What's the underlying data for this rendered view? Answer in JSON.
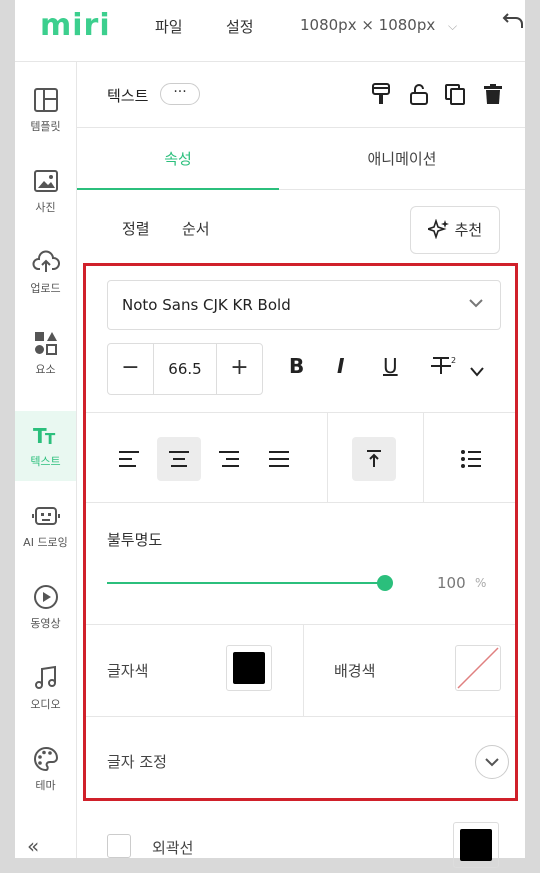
{
  "app": {
    "logo": "miri"
  },
  "topbar": {
    "menu_file": "파일",
    "menu_settings": "설정",
    "canvas_size": "1080px × 1080px"
  },
  "sidenav": {
    "items": [
      {
        "label": "템플릿"
      },
      {
        "label": "사진"
      },
      {
        "label": "업로드"
      },
      {
        "label": "요소"
      },
      {
        "label": "텍스트"
      },
      {
        "label": "AI 드로잉"
      },
      {
        "label": "동영상"
      },
      {
        "label": "오디오"
      },
      {
        "label": "테마"
      }
    ],
    "collapse": "«"
  },
  "panel": {
    "title": "텍스트",
    "more": "···",
    "tabs": [
      {
        "label": "속성"
      },
      {
        "label": "애니메이션"
      }
    ],
    "sub_align": "정렬",
    "sub_order": "순서",
    "recommend": "추천",
    "font": {
      "name": "Noto Sans CJK KR Bold"
    },
    "size": {
      "value": "66.5",
      "minus": "−",
      "plus": "+"
    },
    "format": {
      "bold": "B",
      "italic": "I",
      "underline": "U"
    },
    "opacity": {
      "label": "불투명도",
      "value": "100",
      "unit": "%",
      "fraction": 1.0
    },
    "colors": {
      "text_label": "글자색",
      "bg_label": "배경색",
      "text_color": "#000000"
    },
    "adjust": {
      "label": "글자 조정"
    },
    "outline": {
      "label": "외곽선",
      "color": "#000000"
    }
  },
  "theme": {
    "accent": "#2bbf7c",
    "highlight": "#d0202a"
  }
}
